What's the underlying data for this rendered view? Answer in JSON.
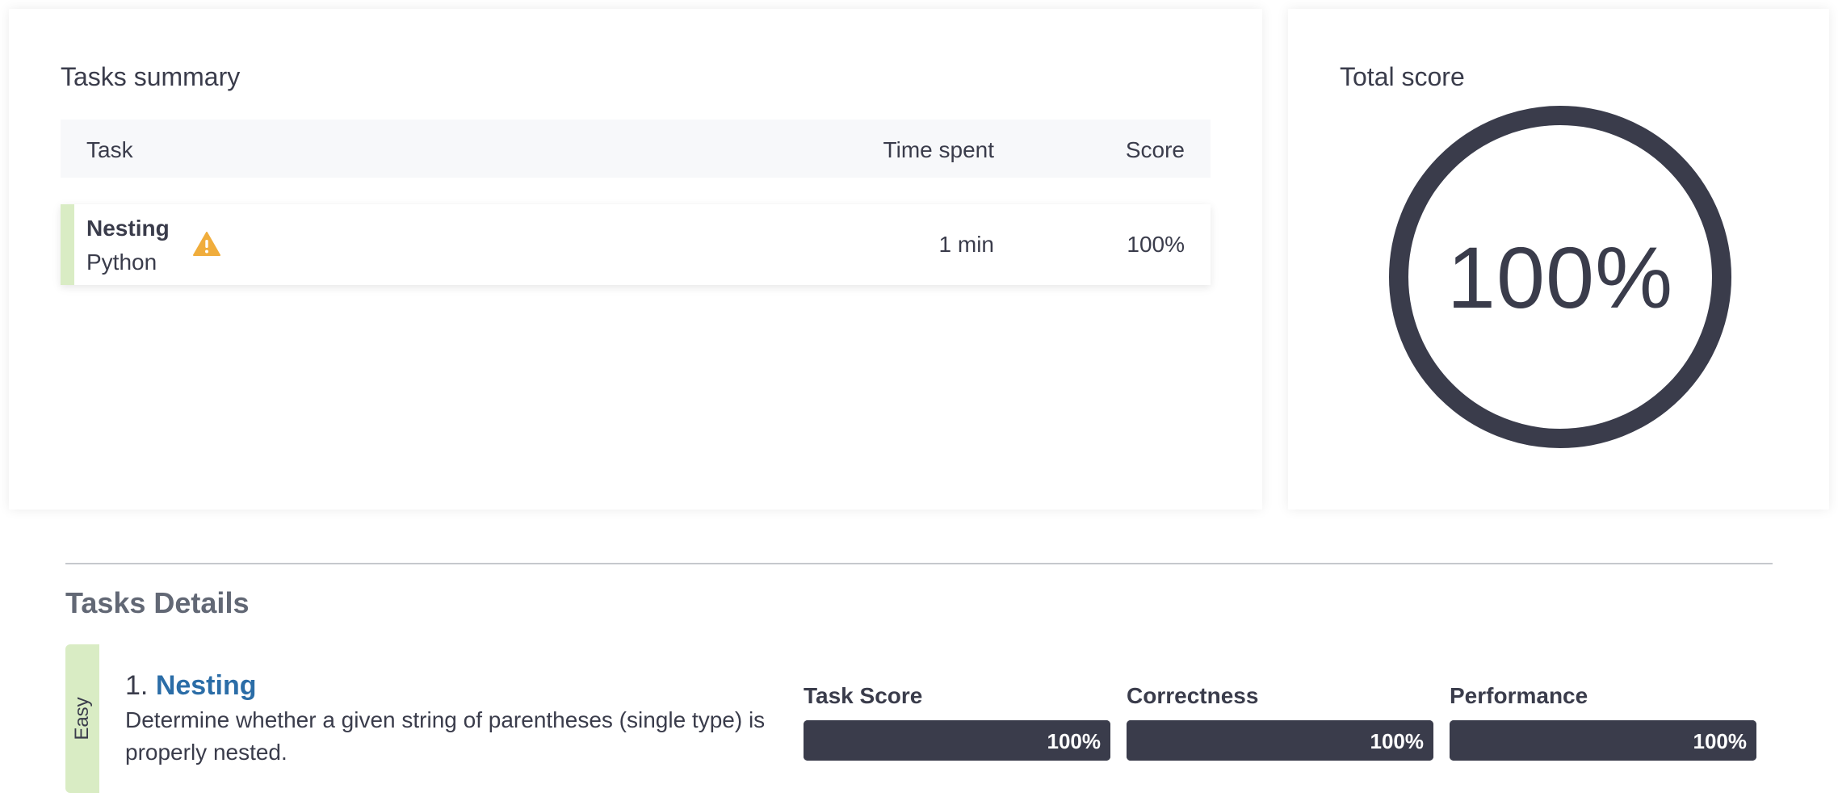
{
  "summary": {
    "title": "Tasks summary",
    "columns": {
      "task": "Task",
      "time": "Time spent",
      "score": "Score"
    },
    "rows": [
      {
        "name": "Nesting",
        "language": "Python",
        "time": "1 min",
        "score": "100%",
        "icon": "warning-icon",
        "stripe_color": "#d9ecc4"
      }
    ]
  },
  "total": {
    "title": "Total score",
    "value": "100%",
    "percent": 100,
    "ring_color": "#3a3c4b"
  },
  "details": {
    "title": "Tasks Details",
    "tasks": [
      {
        "difficulty": "Easy",
        "number": "1.",
        "name": "Nesting",
        "description": "Determine whether a given string of parentheses (single type) is properly nested.",
        "metrics": [
          {
            "label": "Task Score",
            "value": "100%",
            "percent": 100
          },
          {
            "label": "Correctness",
            "value": "100%",
            "percent": 100
          },
          {
            "label": "Performance",
            "value": "100%",
            "percent": 100
          }
        ]
      }
    ]
  },
  "colors": {
    "accent": "#2b6da7",
    "easy": "#d9ecc4",
    "dark": "#3a3c4b",
    "warning": "#f0ad3c"
  }
}
